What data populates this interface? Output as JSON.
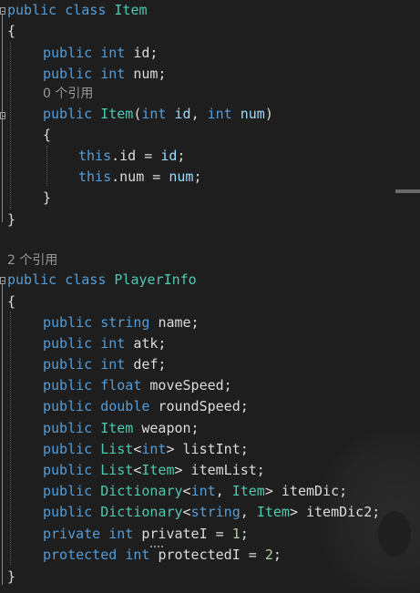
{
  "code": {
    "item_class": {
      "decl_kw1": "public",
      "decl_kw2": "class",
      "decl_name": "Item",
      "open_brace": "{",
      "field1": {
        "mod": "public",
        "type": "int",
        "name": "id;"
      },
      "field2": {
        "mod": "public",
        "type": "int",
        "name": "num;"
      },
      "lens": "0 个引用",
      "ctor": {
        "mod": "public",
        "name": "Item",
        "open_paren": "(",
        "p1_type": "int",
        "p1_name": "id",
        "comma": ", ",
        "p2_type": "int",
        "p2_name": "num",
        "close_paren": ")"
      },
      "ctor_open_brace": "{",
      "assign1": {
        "this": "this",
        "member": ".id",
        "eq": " = ",
        "value": "id",
        "semi": ";"
      },
      "assign2": {
        "this": "this",
        "member": ".num",
        "eq": " = ",
        "value": "num",
        "semi": ";"
      },
      "ctor_close_brace": "}",
      "close_brace": "}"
    },
    "player_class": {
      "lens": "2 个引用",
      "decl_kw1": "public",
      "decl_kw2": "class",
      "decl_name": "PlayerInfo",
      "open_brace": "{",
      "f1": {
        "mod": "public",
        "type": "string",
        "name": "name;"
      },
      "f2": {
        "mod": "public",
        "type": "int",
        "name": "atk;"
      },
      "f3": {
        "mod": "public",
        "type": "int",
        "name": "def;"
      },
      "f4": {
        "mod": "public",
        "type": "float",
        "name": "moveSpeed;"
      },
      "f5": {
        "mod": "public",
        "type": "double",
        "name": "roundSpeed;"
      },
      "f6": {
        "mod": "public",
        "type": "Item",
        "name": "weapon;"
      },
      "f7": {
        "mod": "public",
        "generic": "List",
        "lt": "<",
        "arg": "int",
        "gt": ">",
        "name": " listInt;"
      },
      "f8": {
        "mod": "public",
        "generic": "List",
        "lt": "<",
        "arg": "Item",
        "gt": ">",
        "name": " itemList;"
      },
      "f9": {
        "mod": "public",
        "generic": "Dictionary",
        "lt": "<",
        "arg1": "int",
        "comma": ", ",
        "arg2": "Item",
        "gt": ">",
        "name": " itemDic;"
      },
      "f10": {
        "mod": "public",
        "generic": "Dictionary",
        "lt": "<",
        "arg1": "string",
        "comma": ", ",
        "arg2": "Item",
        "gt": ">",
        "name": " itemDic2;"
      },
      "f11": {
        "mod": "private",
        "type": "int",
        "name": "privateI",
        "eq": " = ",
        "value": "1",
        "semi": ";"
      },
      "f12": {
        "mod": "protected",
        "type": "int",
        "name": "protectedI",
        "eq": " = ",
        "value": "2",
        "semi": ";"
      },
      "close_brace": "}"
    }
  },
  "colors": {
    "background": "#1e1e1e",
    "keyword": "#569cd6",
    "type": "#4ec9b0",
    "identifier": "#dcdcdc",
    "parameter": "#9cdcfe",
    "number": "#b5cea8",
    "codelens": "#999999"
  }
}
